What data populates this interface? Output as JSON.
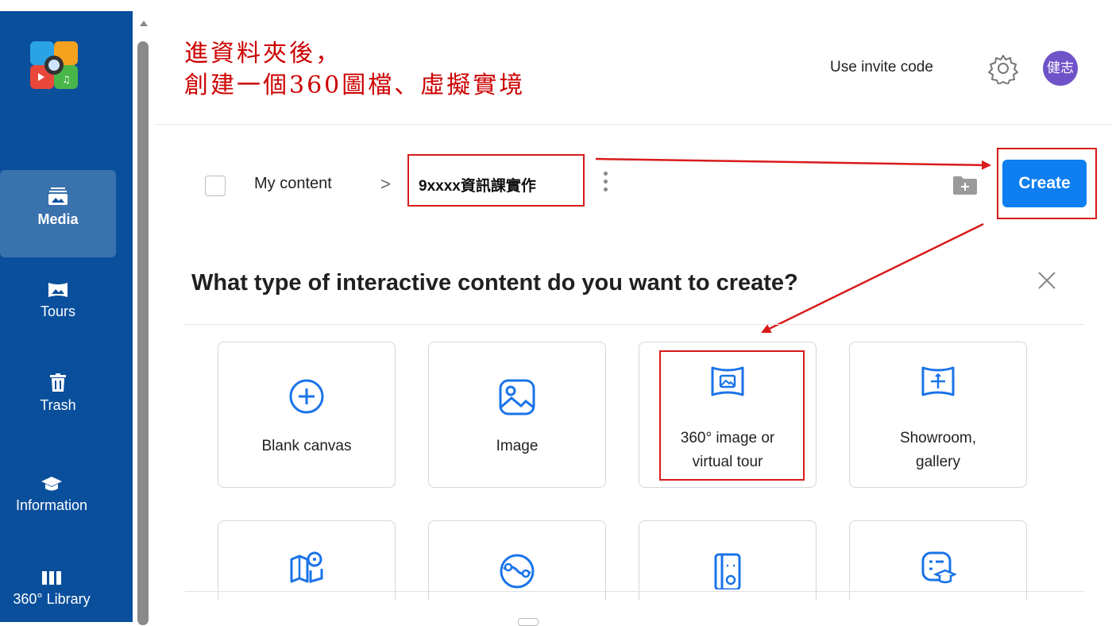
{
  "annotation": {
    "line1": "進資料夾後，",
    "line2": "創建一個360圖檔、虛擬實境"
  },
  "sidebar": {
    "items": [
      {
        "label": "Media",
        "icon": "media-icon",
        "active": true
      },
      {
        "label": "Tours",
        "icon": "tours-icon",
        "active": false
      },
      {
        "label": "Trash",
        "icon": "trash-icon",
        "active": false
      },
      {
        "label": "Information",
        "icon": "graduation-cap-icon",
        "active": false
      },
      {
        "label": "360° Library",
        "icon": "library-icon",
        "active": false
      }
    ]
  },
  "header": {
    "invite_label": "Use invite code",
    "avatar_text": "健志"
  },
  "breadcrumb": {
    "root": "My content",
    "separator": ">",
    "current": "9xxxx資訊課實作"
  },
  "toolbar": {
    "create_label": "Create"
  },
  "dialog": {
    "title": "What type of interactive content do you want to create?",
    "options": [
      {
        "label": "Blank canvas",
        "icon": "plus-circle-icon"
      },
      {
        "label": "Image",
        "icon": "image-icon"
      },
      {
        "label": "360° image or virtual tour",
        "line1": "360° image or",
        "line2": "virtual tour",
        "icon": "panorama-icon"
      },
      {
        "label": "Showroom, gallery",
        "line1": "Showroom,",
        "line2": "gallery",
        "icon": "showroom-icon"
      }
    ],
    "more_options_icons": [
      "map-pin-icon",
      "globe-icon",
      "floorplan-icon",
      "quiz-icon"
    ]
  },
  "colors": {
    "sidebar": "#0a4f9c",
    "sidebar_active": "#3a72ae",
    "primary": "#0e7ef0",
    "annotation": "#cc0000",
    "avatar": "#6f53c8"
  }
}
